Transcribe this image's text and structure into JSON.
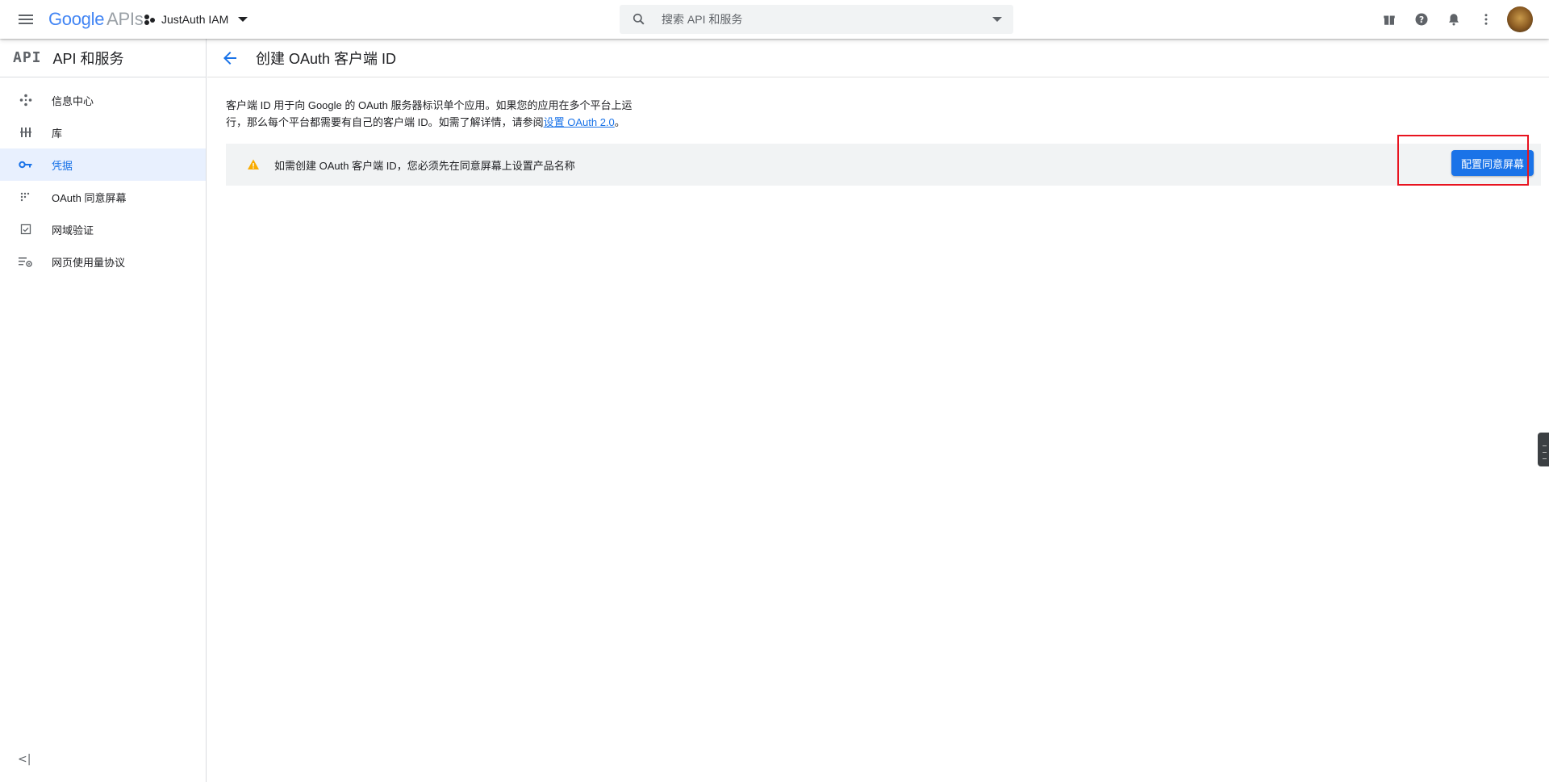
{
  "topbar": {
    "logo_google": "Google",
    "logo_apis": "APIs",
    "project_name": "JustAuth IAM",
    "search_placeholder": "搜索 API 和服务",
    "icons": [
      "menu-icon",
      "gift-icon",
      "help-icon",
      "bell-icon",
      "more-vert-icon",
      "avatar"
    ]
  },
  "sidebar": {
    "logo_text": "API",
    "title": "API 和服务",
    "items": [
      {
        "label": "信息中心",
        "icon": "dashboard-icon",
        "active": false
      },
      {
        "label": "库",
        "icon": "library-icon",
        "active": false
      },
      {
        "label": "凭据",
        "icon": "key-icon",
        "active": true
      },
      {
        "label": "OAuth 同意屏幕",
        "icon": "consent-icon",
        "active": false
      },
      {
        "label": "网域验证",
        "icon": "domain-check-icon",
        "active": false
      },
      {
        "label": "网页使用量协议",
        "icon": "agreement-icon",
        "active": false
      }
    ],
    "collapse_label": "<|"
  },
  "main": {
    "title": "创建 OAuth 客户端 ID",
    "desc_part1": "客户端 ID 用于向 Google 的 OAuth 服务器标识单个应用。如果您的应用在多个平台上运行，那么每个平台都需要有自己的客户端 ID。如需了解详情，请参阅",
    "desc_link": "设置 OAuth 2.0",
    "desc_part2": "。",
    "banner_text": "如需创建 OAuth 客户端 ID，您必须先在同意屏幕上设置产品名称",
    "configure_button": "配置同意屏幕"
  },
  "colors": {
    "accent": "#1a73e8",
    "active_bg": "#e8f0fe",
    "warning": "#f9ab00",
    "highlight": "#e8131f"
  }
}
